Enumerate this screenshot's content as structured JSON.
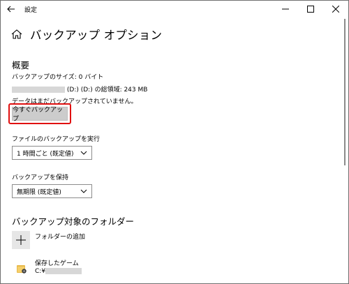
{
  "window": {
    "title": "設定"
  },
  "page": {
    "title": "バックアップ オプション"
  },
  "overview": {
    "heading": "概要",
    "size_line": "バックアップのサイズ: 0 バイト",
    "drive_line": "(D:) (D:) の総領域: 243 MB",
    "status_line": "データはまだバックアップされていません。",
    "backup_now": "今すぐバックアップ"
  },
  "schedule": {
    "label": "ファイルのバックアップを実行",
    "selected": "1 時間ごと (既定値)"
  },
  "retention": {
    "label": "バックアップを保持",
    "selected": "無期限 (既定値)"
  },
  "folders": {
    "heading": "バックアップ対象のフォルダー",
    "add_label": "フォルダーの追加",
    "items": [
      {
        "name": "保存したゲーム",
        "path": "C:¥"
      }
    ]
  },
  "colors": {
    "highlight": "#e01010",
    "button": "#cccccc"
  }
}
